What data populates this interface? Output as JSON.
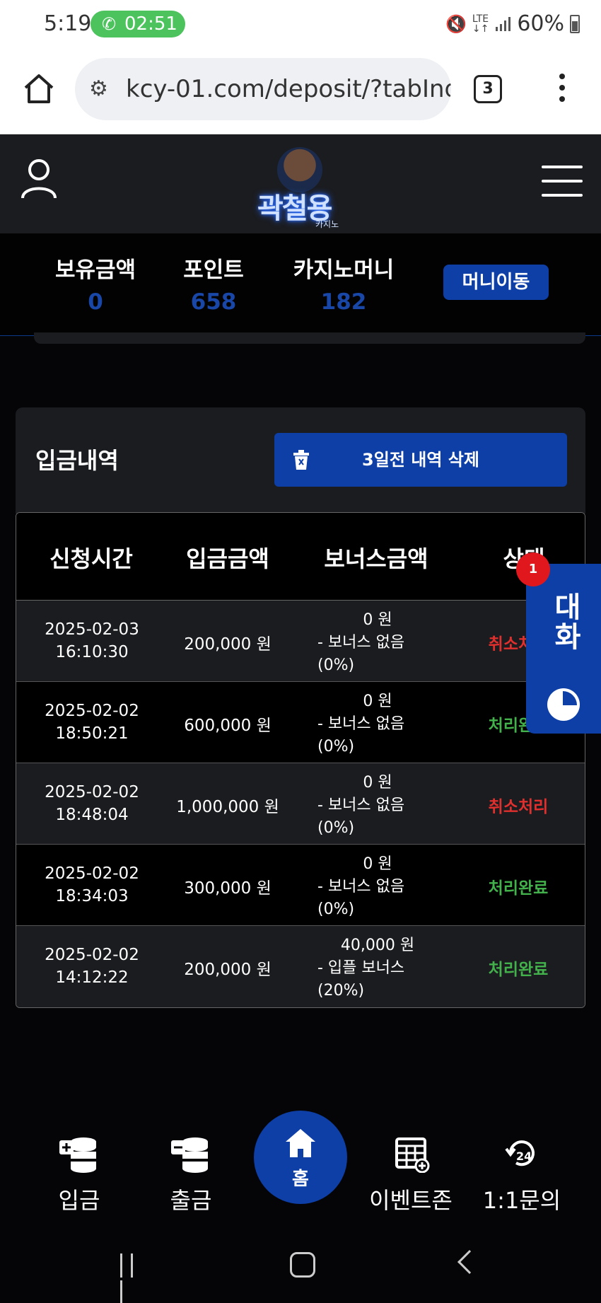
{
  "status_bar": {
    "time": "5:19",
    "call_timer": "02:51",
    "battery": "60%"
  },
  "browser": {
    "url": "kcy-01.com/deposit/?tabInd",
    "tab_count": "3"
  },
  "site": {
    "logo_text": "곽철용",
    "logo_sub": "카지노"
  },
  "balances": [
    {
      "label": "보유금액",
      "value": "0"
    },
    {
      "label": "포인트",
      "value": "658"
    },
    {
      "label": "카지노머니",
      "value": "182"
    }
  ],
  "money_move_label": "머니이동",
  "deposit_history": {
    "title": "입금내역",
    "delete_button_label": "3일전 내역 삭제",
    "columns": [
      "신청시간",
      "입금금액",
      "보너스금액",
      "상태"
    ],
    "rows": [
      {
        "date": "2025-02-03",
        "time": "16:10:30",
        "amount": "200,000 원",
        "bonus_amount": "0 원",
        "bonus_name": "- 보너스 없음",
        "bonus_pct": "(0%)",
        "status": "취소처리"
      },
      {
        "date": "2025-02-02",
        "time": "18:50:21",
        "amount": "600,000 원",
        "bonus_amount": "0 원",
        "bonus_name": "- 보너스 없음",
        "bonus_pct": "(0%)",
        "status": "처리완료"
      },
      {
        "date": "2025-02-02",
        "time": "18:48:04",
        "amount": "1,000,000 원",
        "bonus_amount": "0 원",
        "bonus_name": "- 보너스 없음",
        "bonus_pct": "(0%)",
        "status": "취소처리"
      },
      {
        "date": "2025-02-02",
        "time": "18:34:03",
        "amount": "300,000 원",
        "bonus_amount": "0 원",
        "bonus_name": "- 보너스 없음",
        "bonus_pct": "(0%)",
        "status": "처리완료"
      },
      {
        "date": "2025-02-02",
        "time": "14:12:22",
        "amount": "200,000 원",
        "bonus_amount": "40,000 원",
        "bonus_name": "- 입플 보너스",
        "bonus_pct": "(20%)",
        "status": "처리완료"
      }
    ]
  },
  "chat_widget": {
    "label": "대화",
    "badge": "1"
  },
  "bottom_nav": {
    "deposit": "입금",
    "withdraw": "출금",
    "home": "홈",
    "event": "이벤트존",
    "inquiry": "1:1문의"
  },
  "colors": {
    "accent": "#0d3fa6",
    "cancel": "#e0302e",
    "done": "#43b14b",
    "balance_value": "#1947a8"
  }
}
